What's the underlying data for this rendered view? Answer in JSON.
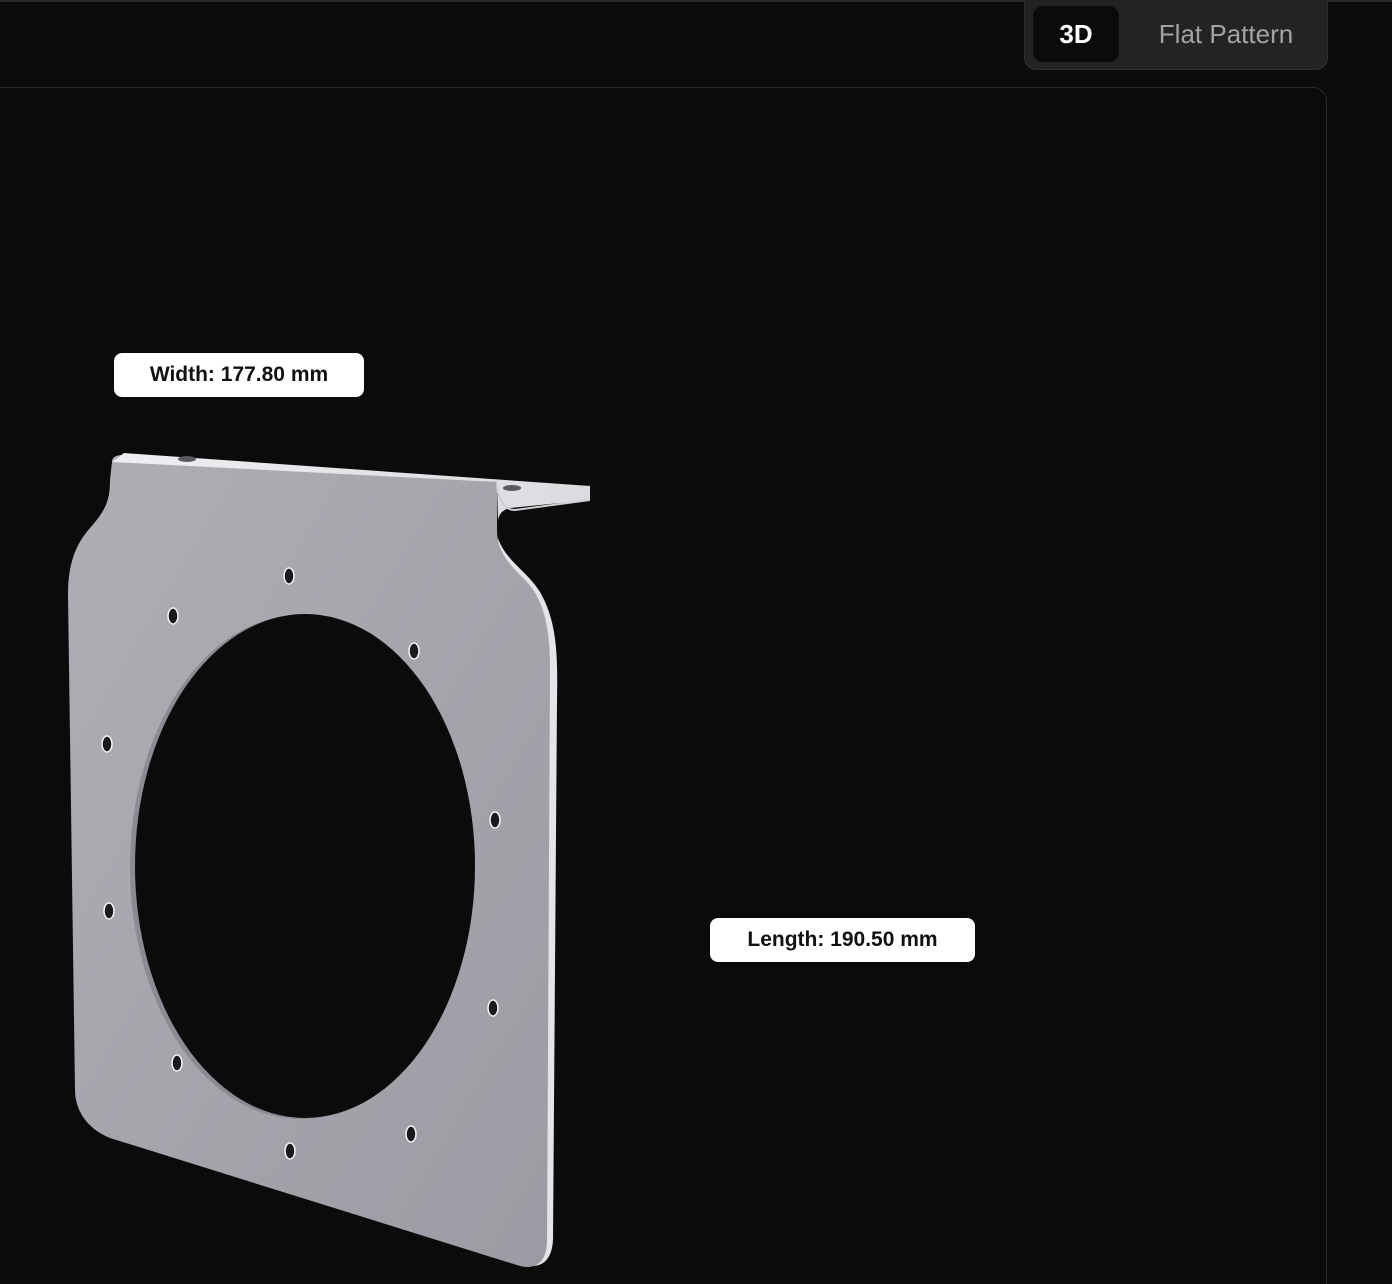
{
  "view_toggle": {
    "options": [
      "3D",
      "Flat Pattern"
    ],
    "selected": "3D"
  },
  "dimensions": {
    "width_label": "Width: 177.80 mm",
    "length_label": "Length: 190.50 mm"
  },
  "colors": {
    "background": "#0b0b0c",
    "part_face": "#a6a3ab",
    "part_edge": "#e7e6ea",
    "label_bg": "#ffffff",
    "toggle_bg": "#232325"
  }
}
